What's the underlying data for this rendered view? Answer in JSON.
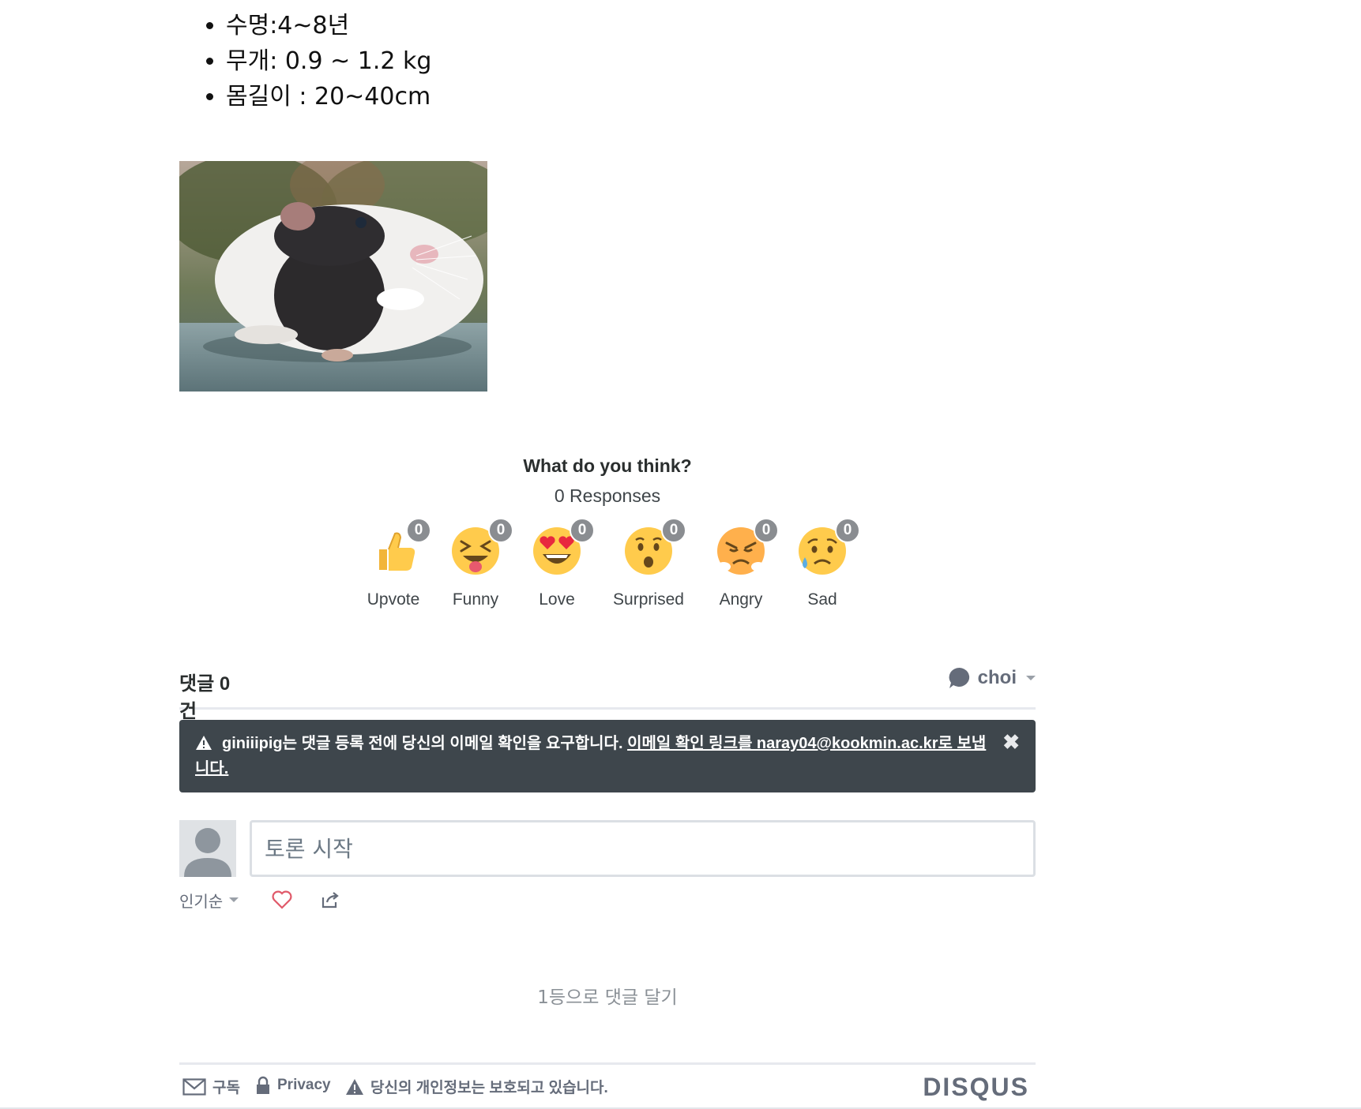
{
  "post": {
    "facts": [
      "수명:4~8년",
      "무개: 0.9 ~ 1.2 kg",
      "몸길이 : 20~40cm"
    ]
  },
  "reactions": {
    "title": "What do you think?",
    "responses": "0 Responses",
    "items": [
      {
        "label": "Upvote",
        "count": "0",
        "icon": "thumbs-up-icon"
      },
      {
        "label": "Funny",
        "count": "0",
        "icon": "laughing-face-icon"
      },
      {
        "label": "Love",
        "count": "0",
        "icon": "heart-eyes-icon"
      },
      {
        "label": "Surprised",
        "count": "0",
        "icon": "surprised-face-icon"
      },
      {
        "label": "Angry",
        "count": "0",
        "icon": "angry-face-icon"
      },
      {
        "label": "Sad",
        "count": "0",
        "icon": "sad-face-icon"
      }
    ]
  },
  "comments": {
    "tab_label": "댓글 0건",
    "user": "choi",
    "alert": {
      "message": "giniiipig는 댓글 등록 전에 당신의 이메일 확인을 요구합니다. ",
      "link": "이메일 확인 링크를 naray04@kookmin.ac.kr로 보냅니다.",
      "close": "✖"
    },
    "composer_placeholder": "토론 시작",
    "sort_label": "인기순",
    "empty_note": "1등으로 댓글 달기"
  },
  "footer": {
    "subscribe": "구독",
    "privacy": "Privacy",
    "privacy_note": "당신의 개인정보는 보호되고 있습니다.",
    "logo": "DISQUS"
  },
  "colors": {
    "alert_bg": "#3e464c",
    "muted": "#656c7a",
    "heart": "#e05a6a"
  }
}
